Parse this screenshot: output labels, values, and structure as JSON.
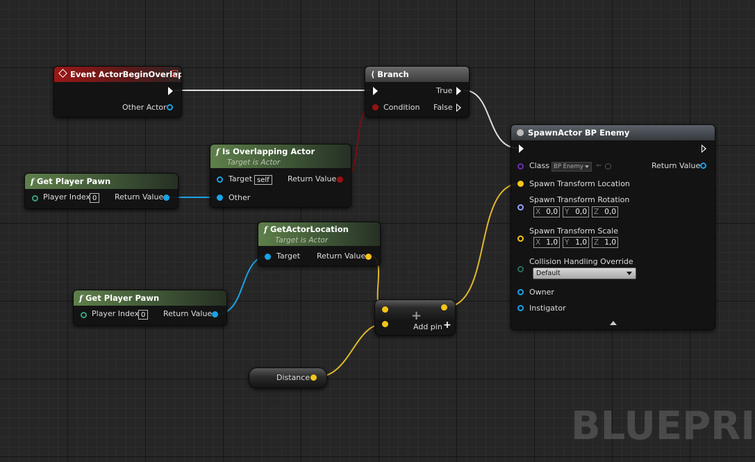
{
  "nodes": {
    "event": {
      "title": "Event ActorBeginOverlap",
      "other_actor": "Other Actor"
    },
    "branch": {
      "title": "Branch",
      "condition": "Condition",
      "true_label": "True",
      "false_label": "False"
    },
    "overlap": {
      "title": "Is Overlapping Actor",
      "subtitle": "Target is Actor",
      "target": "Target",
      "target_value": "self",
      "other": "Other",
      "return_value": "Return Value"
    },
    "pawn1": {
      "title": "Get Player Pawn",
      "player_index": "Player Index",
      "index_value": "0",
      "return_value": "Return Value"
    },
    "location": {
      "title": "GetActorLocation",
      "subtitle": "Target is Actor",
      "target": "Target",
      "return_value": "Return Value"
    },
    "pawn2": {
      "title": "Get Player Pawn",
      "player_index": "Player Index",
      "index_value": "0",
      "return_value": "Return Value"
    },
    "add": {
      "op": "+",
      "add_pin": "Add pin",
      "add_pin_icon": "+"
    },
    "distance": {
      "label": "Distance"
    },
    "spawn": {
      "title": "SpawnActor BP Enemy",
      "class_label": "Class",
      "class_value": "BP Enemy",
      "return_value": "Return Value",
      "location_label": "Spawn Transform Location",
      "rotation_label": "Spawn Transform Rotation",
      "rotation": {
        "x_axis": "X",
        "x": "0,0",
        "y_axis": "Y",
        "y": "0,0",
        "z_axis": "Z",
        "z": "0,0"
      },
      "scale_label": "Spawn Transform Scale",
      "scale": {
        "x_axis": "X",
        "x": "1,0",
        "y_axis": "Y",
        "y": "1,0",
        "z_axis": "Z",
        "z": "1,0"
      },
      "collision_label": "Collision Handling Override",
      "collision_value": "Default",
      "owner_label": "Owner",
      "instigator_label": "Instigator"
    }
  },
  "watermark": "BLUEPRINT",
  "colors": {
    "exec": "#ffffff",
    "object": "#1aa3e6",
    "bool": "#8c1010",
    "vector": "#f5c518",
    "class": "#6a2fb0",
    "struct": "#3aa7b7",
    "enum": "#2a6e5e"
  }
}
